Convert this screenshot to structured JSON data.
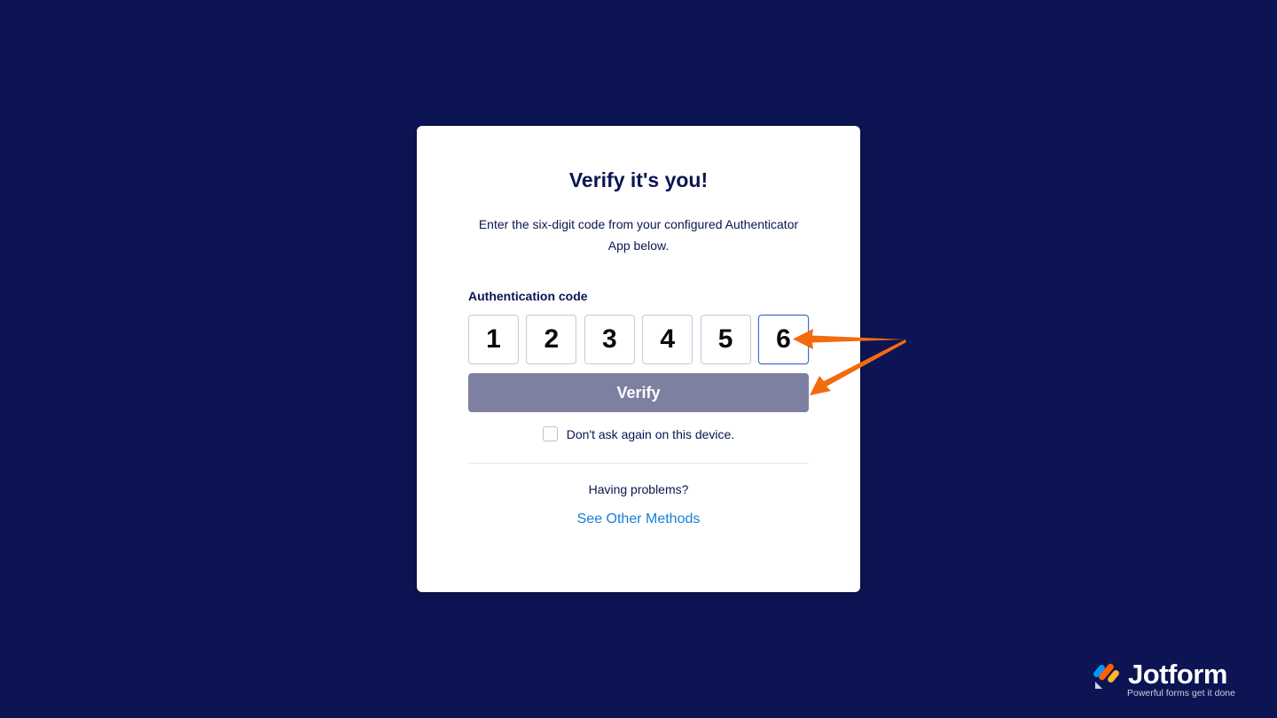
{
  "dialog": {
    "title": "Verify it's you!",
    "subtitle": "Enter the six-digit code from your configured Authenticator App below.",
    "code_label": "Authentication code",
    "digits": [
      "1",
      "2",
      "3",
      "4",
      "5",
      "6"
    ],
    "verify_label": "Verify",
    "remember_label": "Don't ask again on this device.",
    "remember_checked": false,
    "problems_text": "Having problems?",
    "other_methods_label": "See Other Methods"
  },
  "brand": {
    "name": "Jotform",
    "tagline": "Powerful forms get it done",
    "logo_icon": "jotform-logo-icon"
  },
  "colors": {
    "background": "#0c1454",
    "title": "#0a1551",
    "verify_button": "#7d80a0",
    "link": "#1a7ed6",
    "annotation_arrow": "#f26b0f"
  }
}
